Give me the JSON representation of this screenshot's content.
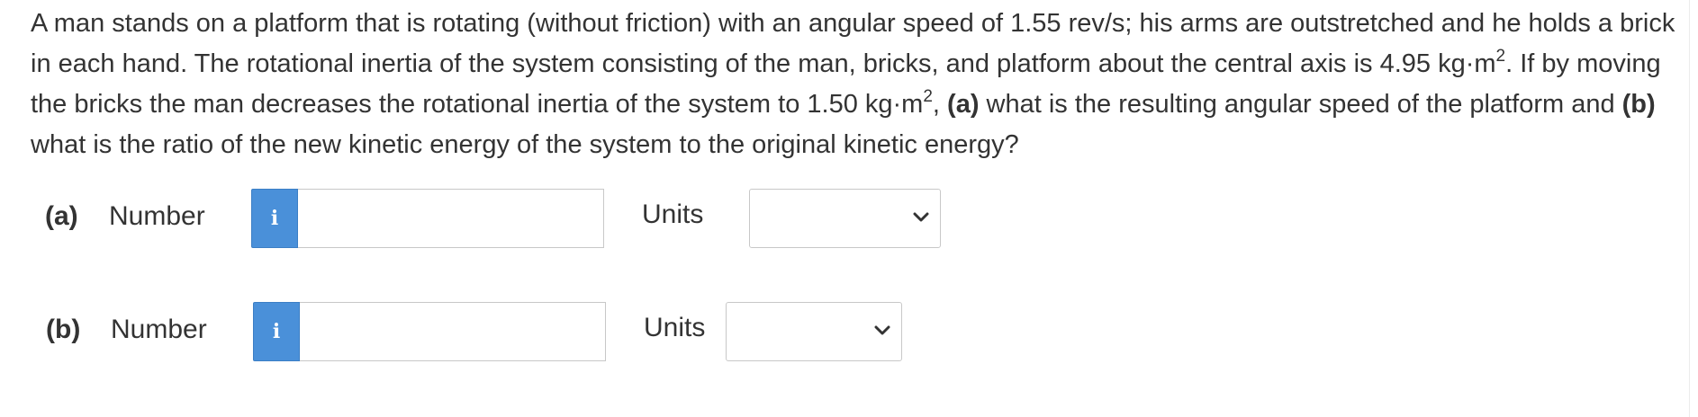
{
  "question": {
    "intro": "A man stands on a platform that is rotating (without friction) with an angular speed of 1.55 rev/s; his arms are outstretched and he holds a brick in each hand. The rotational inertia of the system consisting of the man, bricks, and platform about the central axis is 4.95 kg·m",
    "exp1": "2",
    "mid": ". If by moving the bricks the man decreases the rotational inertia of the system to 1.50 kg·m",
    "exp2": "2",
    "mid2": ", ",
    "part_a_marker": "(a)",
    "part_a_text": " what is the resulting angular speed of the platform and ",
    "part_b_marker": "(b)",
    "part_b_text": " what is the ratio of the new kinetic energy of the system to the original kinetic energy?"
  },
  "answers": [
    {
      "part_label": "(a)",
      "number_label": "Number",
      "info_glyph": "i",
      "number_value": "",
      "units_label": "Units",
      "units_selected": ""
    },
    {
      "part_label": "(b)",
      "number_label": "Number",
      "info_glyph": "i",
      "number_value": "",
      "units_label": "Units",
      "units_selected": ""
    }
  ],
  "colors": {
    "info_button": "#4a90d9",
    "text": "#333333",
    "border": "#c8c8c8"
  },
  "icons": {
    "info": "info-icon",
    "dropdown": "chevron-down-icon"
  }
}
